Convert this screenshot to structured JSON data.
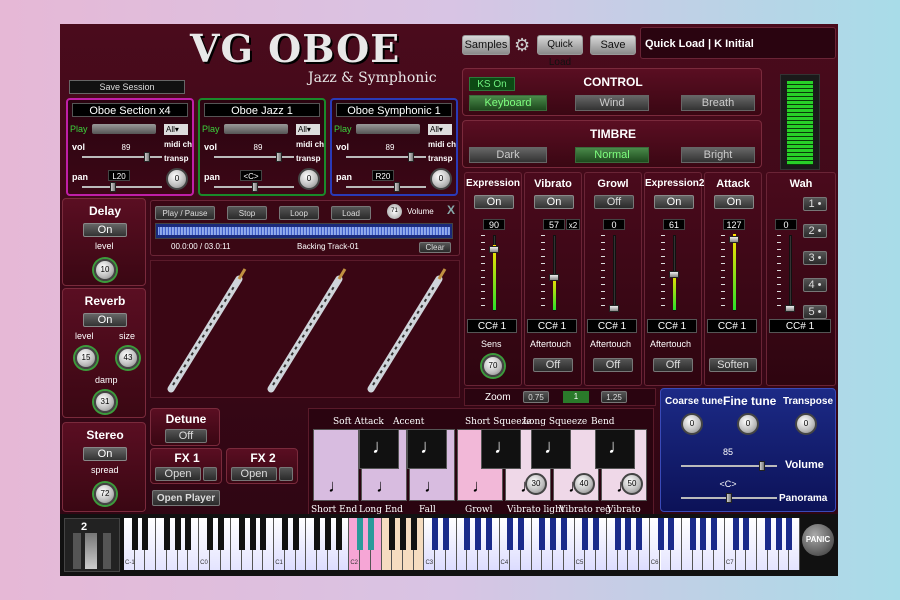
{
  "header": {
    "title": "VG OBOE",
    "subtitle": "Jazz & Symphonic",
    "samples": "Samples",
    "quick_load_btn": "Quick Load",
    "save": "Save",
    "quick_load_info": "Quick Load | K Initial",
    "save_session": "Save Session"
  },
  "sections": [
    {
      "name": "Oboe Section x4",
      "play": "Play",
      "all": "All",
      "vol": "vol",
      "vol_value": "89",
      "midi_ch": "midi ch",
      "transp": "transp",
      "pan": "pan",
      "pan_value": "L20",
      "transp_value": "0",
      "color": "#c01fa8"
    },
    {
      "name": "Oboe Jazz 1",
      "play": "Play",
      "all": "All",
      "vol": "vol",
      "vol_value": "89",
      "midi_ch": "midi ch",
      "transp": "transp",
      "pan": "pan",
      "pan_value": "<C>",
      "transp_value": "0",
      "color": "#1a8a2a"
    },
    {
      "name": "Oboe Symphonic 1",
      "play": "Play",
      "all": "All",
      "vol": "vol",
      "vol_value": "89",
      "midi_ch": "midi ch",
      "transp": "transp",
      "pan": "pan",
      "pan_value": "R20",
      "transp_value": "0",
      "color": "#2a3ab8"
    }
  ],
  "control": {
    "title": "CONTROL",
    "ks": "KS On",
    "keyboard": "Keyboard",
    "wind": "Wind",
    "breath": "Breath"
  },
  "timbre": {
    "title": "TIMBRE",
    "dark": "Dark",
    "normal": "Normal",
    "bright": "Bright"
  },
  "delay": {
    "title": "Delay",
    "on": "On",
    "level": "level",
    "value": "10"
  },
  "reverb": {
    "title": "Reverb",
    "on": "On",
    "level": "level",
    "size": "size",
    "level_value": "15",
    "size_value": "43",
    "damp": "damp",
    "damp_value": "31"
  },
  "stereo": {
    "title": "Stereo",
    "on": "On",
    "spread": "spread",
    "value": "72"
  },
  "player": {
    "play_pause": "Play / Pause",
    "stop": "Stop",
    "loop": "Loop",
    "load": "Load",
    "volume_value": "71",
    "volume": "Volume",
    "close": "X",
    "time": "00.0:00 / 03.0:11",
    "track": "Backing Track-01",
    "clear": "Clear"
  },
  "strips": [
    {
      "title": "Expression",
      "on": "On",
      "value": "90",
      "cc": "CC# 1",
      "sens": "Sens",
      "sens_value": "70",
      "level": 0.85
    },
    {
      "title": "Vibrato",
      "on": "On",
      "value": "57",
      "x2": "x2",
      "cc": "CC# 1",
      "after": "Aftertouch",
      "off": "Off",
      "level": 0.45
    },
    {
      "title": "Growl",
      "on": "Off",
      "value": "0",
      "cc": "CC# 1",
      "after": "Aftertouch",
      "off": "Off",
      "level": 0.0
    },
    {
      "title": "Expression2",
      "on": "On",
      "value": "61",
      "cc": "CC# 1",
      "after": "Aftertouch",
      "off": "Off",
      "level": 0.5
    },
    {
      "title": "Attack",
      "on": "On",
      "value": "127",
      "cc": "CC# 1",
      "soften": "Soften",
      "level": 1.0
    },
    {
      "title": "Wah",
      "value": "0",
      "cc": "CC# 1",
      "buttons": [
        "1",
        "2",
        "3",
        "4",
        "5"
      ],
      "level": 0.0
    }
  ],
  "zoom": {
    "label": "Zoom",
    "options": [
      "0.75",
      "1",
      "1.25"
    ]
  },
  "detune": {
    "title": "Detune",
    "off": "Off"
  },
  "fx1": {
    "title": "FX 1",
    "open": "Open"
  },
  "fx2": {
    "title": "FX 2",
    "open": "Open"
  },
  "open_player": "Open Player",
  "articulations": {
    "top": [
      "Soft Attack",
      "Accent",
      "Short Squeeze",
      "Long Squeeze",
      "Bend"
    ],
    "bottom": [
      "Short End",
      "Long End",
      "Fall",
      "Growl",
      "Vibrato light",
      "Vibrato reg",
      "Vibrato int"
    ],
    "knobs": [
      "30",
      "40",
      "50"
    ]
  },
  "tune": {
    "coarse": "Coarse tune",
    "fine": "Fine tune",
    "transpose": "Transpose",
    "coarse_value": "0",
    "fine_value": "0",
    "transpose_value": "0",
    "volume": "Volume",
    "volume_value": "85",
    "panorama": "Panorama",
    "pan_value": "<C>"
  },
  "keyboard": {
    "octave": "2",
    "labels": [
      "C-1",
      "C0",
      "C1",
      "C2",
      "C3",
      "C4",
      "C5",
      "C6",
      "C7"
    ],
    "panic": "PANIC"
  }
}
